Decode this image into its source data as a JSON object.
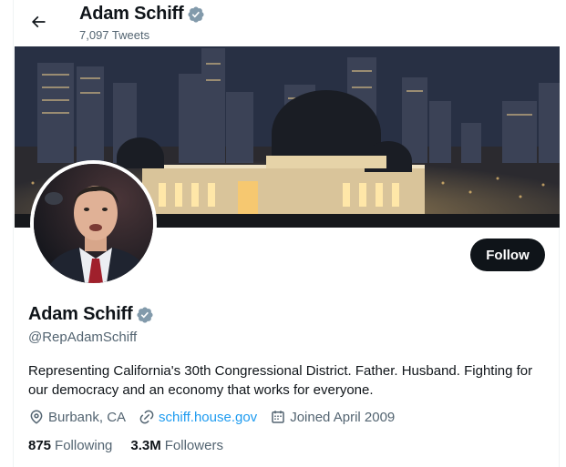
{
  "header": {
    "name": "Adam Schiff",
    "tweet_count": "7,097 Tweets",
    "back_icon": "arrow-left-icon"
  },
  "profile": {
    "name": "Adam Schiff",
    "handle": "@RepAdamSchiff",
    "verified_icon": "verified-badge-icon",
    "bio": "Representing California's 30th Congressional District. Father. Husband. Fighting for our democracy and an economy that works for everyone.",
    "location": "Burbank, CA",
    "website": "schiff.house.gov",
    "joined": "Joined April 2009",
    "following_count": "875",
    "following_label": "Following",
    "followers_count": "3.3M",
    "followers_label": "Followers"
  },
  "actions": {
    "follow_label": "Follow"
  },
  "colors": {
    "text_primary": "#0f1419",
    "text_secondary": "#536471",
    "accent": "#1d9bf0",
    "follow_bg": "#0f1419",
    "verified": "#829aab"
  }
}
